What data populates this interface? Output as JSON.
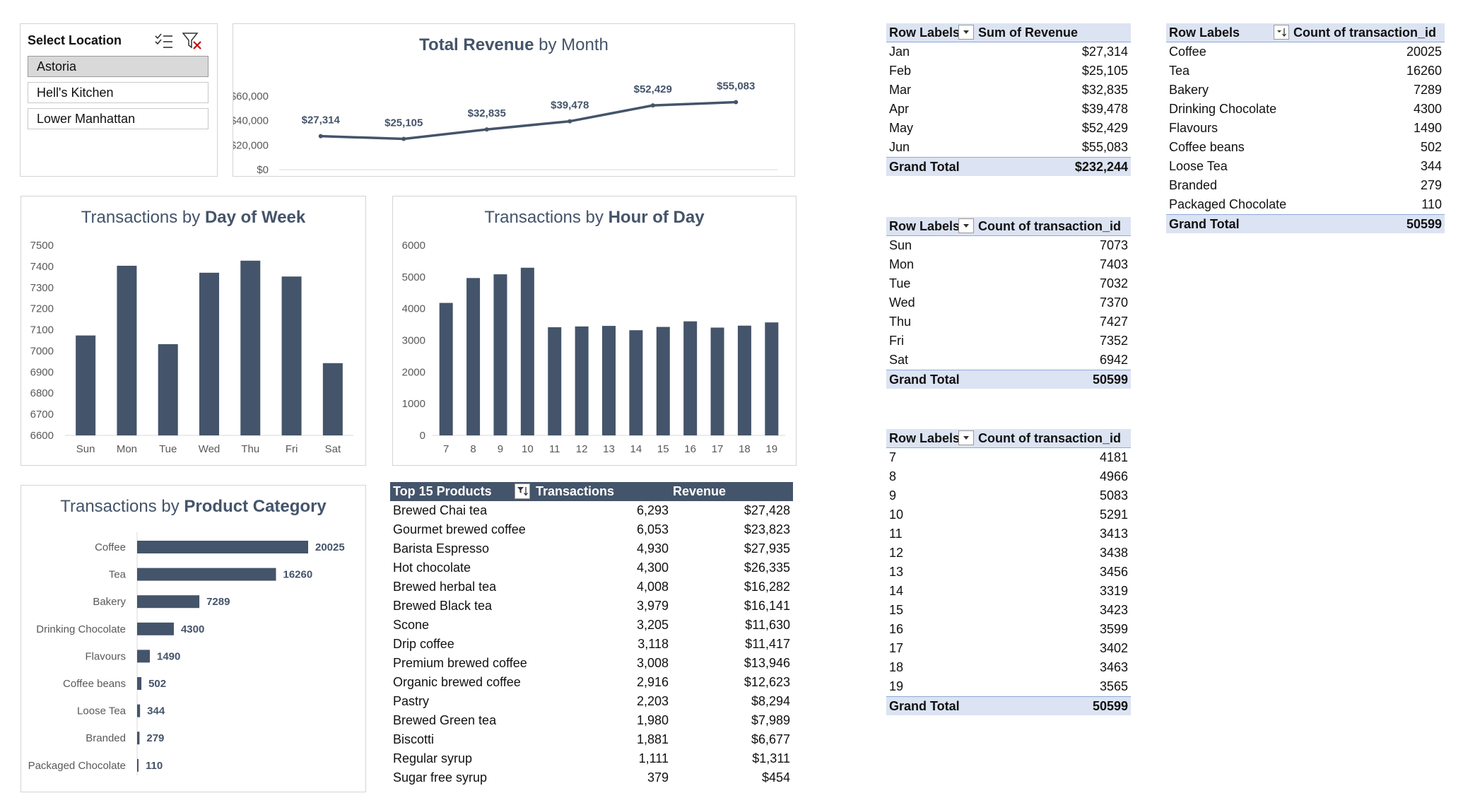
{
  "colors": {
    "bar": "#44546a",
    "header_fill": "#dce3f2",
    "header_border": "#8ea9db",
    "table_header": "#44546a"
  },
  "slicer": {
    "title": "Select Location",
    "icons": [
      "multi-select-icon",
      "clear-filter-icon"
    ],
    "items": [
      {
        "label": "Astoria",
        "selected": true
      },
      {
        "label": "Hell's Kitchen",
        "selected": false
      },
      {
        "label": "Lower Manhattan",
        "selected": false
      }
    ]
  },
  "revenue_chart": {
    "title_plain": "Total Revenue ",
    "title_bold": "by Month"
  },
  "dow_chart": {
    "title_plain": "Transactions by ",
    "title_bold": "Day of Week"
  },
  "hour_chart": {
    "title_plain": "Transactions by ",
    "title_bold": "Hour of Day"
  },
  "category_chart": {
    "title_plain": "Transactions by ",
    "title_bold": "Product Category"
  },
  "chart_data": [
    {
      "type": "line",
      "title": "Total Revenue by Month",
      "categories": [
        "Jan",
        "Feb",
        "Mar",
        "Apr",
        "May",
        "Jun"
      ],
      "values": [
        27314,
        25105,
        32835,
        39478,
        52429,
        55083
      ],
      "data_labels": [
        "$27,314",
        "$25,105",
        "$32,835",
        "$39,478",
        "$52,429",
        "$55,083"
      ],
      "yticks": [
        "$0",
        "$20,000",
        "$40,000",
        "$60,000"
      ],
      "ylim": [
        0,
        60000
      ]
    },
    {
      "type": "bar",
      "title": "Transactions by Day of Week",
      "categories": [
        "Sun",
        "Mon",
        "Tue",
        "Wed",
        "Thu",
        "Fri",
        "Sat"
      ],
      "values": [
        7073,
        7403,
        7032,
        7370,
        7427,
        7352,
        6942
      ],
      "yticks": [
        "6600",
        "6700",
        "6800",
        "6900",
        "7000",
        "7100",
        "7200",
        "7300",
        "7400",
        "7500"
      ],
      "ylim": [
        6600,
        7500
      ]
    },
    {
      "type": "bar",
      "title": "Transactions by Hour of Day",
      "categories": [
        "7",
        "8",
        "9",
        "10",
        "11",
        "12",
        "13",
        "14",
        "15",
        "16",
        "17",
        "18",
        "19"
      ],
      "values": [
        4181,
        4966,
        5083,
        5291,
        3413,
        3438,
        3456,
        3319,
        3423,
        3599,
        3402,
        3463,
        3565
      ],
      "yticks": [
        "0",
        "1000",
        "2000",
        "3000",
        "4000",
        "5000",
        "6000"
      ],
      "ylim": [
        0,
        6000
      ]
    },
    {
      "type": "bar",
      "orientation": "horizontal",
      "title": "Transactions by Product Category",
      "categories": [
        "Coffee",
        "Tea",
        "Bakery",
        "Drinking Chocolate",
        "Flavours",
        "Coffee beans",
        "Loose Tea",
        "Branded",
        "Packaged Chocolate"
      ],
      "values": [
        20025,
        16260,
        7289,
        4300,
        1490,
        502,
        344,
        279,
        110
      ]
    }
  ],
  "top_products": {
    "headers": [
      "Top 15 Products",
      "Transactions",
      "Revenue"
    ],
    "rows": [
      [
        "Brewed Chai tea",
        "6,293",
        "$27,428"
      ],
      [
        "Gourmet brewed coffee",
        "6,053",
        "$23,823"
      ],
      [
        "Barista Espresso",
        "4,930",
        "$27,935"
      ],
      [
        "Hot chocolate",
        "4,300",
        "$26,335"
      ],
      [
        "Brewed herbal tea",
        "4,008",
        "$16,282"
      ],
      [
        "Brewed Black tea",
        "3,979",
        "$16,141"
      ],
      [
        "Scone",
        "3,205",
        "$11,630"
      ],
      [
        "Drip coffee",
        "3,118",
        "$11,417"
      ],
      [
        "Premium brewed coffee",
        "3,008",
        "$13,946"
      ],
      [
        "Organic brewed coffee",
        "2,916",
        "$12,623"
      ],
      [
        "Pastry",
        "2,203",
        "$8,294"
      ],
      [
        "Brewed Green tea",
        "1,980",
        "$7,989"
      ],
      [
        "Biscotti",
        "1,881",
        "$6,677"
      ],
      [
        "Regular syrup",
        "1,111",
        "$1,311"
      ],
      [
        "Sugar free syrup",
        "379",
        "$454"
      ]
    ]
  },
  "pivot_revenue": {
    "headers": [
      "Row Labels",
      "Sum of Revenue"
    ],
    "rows": [
      [
        "Jan",
        "$27,314"
      ],
      [
        "Feb",
        "$25,105"
      ],
      [
        "Mar",
        "$32,835"
      ],
      [
        "Apr",
        "$39,478"
      ],
      [
        "May",
        "$52,429"
      ],
      [
        "Jun",
        "$55,083"
      ]
    ],
    "total": [
      "Grand Total",
      "$232,244"
    ]
  },
  "pivot_dow": {
    "headers": [
      "Row Labels",
      "Count of transaction_id"
    ],
    "rows": [
      [
        "Sun",
        "7073"
      ],
      [
        "Mon",
        "7403"
      ],
      [
        "Tue",
        "7032"
      ],
      [
        "Wed",
        "7370"
      ],
      [
        "Thu",
        "7427"
      ],
      [
        "Fri",
        "7352"
      ],
      [
        "Sat",
        "6942"
      ]
    ],
    "total": [
      "Grand Total",
      "50599"
    ]
  },
  "pivot_hour": {
    "headers": [
      "Row Labels",
      "Count of transaction_id"
    ],
    "rows": [
      [
        "7",
        "4181"
      ],
      [
        "8",
        "4966"
      ],
      [
        "9",
        "5083"
      ],
      [
        "10",
        "5291"
      ],
      [
        "11",
        "3413"
      ],
      [
        "12",
        "3438"
      ],
      [
        "13",
        "3456"
      ],
      [
        "14",
        "3319"
      ],
      [
        "15",
        "3423"
      ],
      [
        "16",
        "3599"
      ],
      [
        "17",
        "3402"
      ],
      [
        "18",
        "3463"
      ],
      [
        "19",
        "3565"
      ]
    ],
    "total": [
      "Grand Total",
      "50599"
    ]
  },
  "pivot_category": {
    "headers": [
      "Row Labels",
      "Count of transaction_id"
    ],
    "rows": [
      [
        "Coffee",
        "20025"
      ],
      [
        "Tea",
        "16260"
      ],
      [
        "Bakery",
        "7289"
      ],
      [
        "Drinking Chocolate",
        "4300"
      ],
      [
        "Flavours",
        "1490"
      ],
      [
        "Coffee beans",
        "502"
      ],
      [
        "Loose Tea",
        "344"
      ],
      [
        "Branded",
        "279"
      ],
      [
        "Packaged Chocolate",
        "110"
      ]
    ],
    "total": [
      "Grand Total",
      "50599"
    ]
  }
}
